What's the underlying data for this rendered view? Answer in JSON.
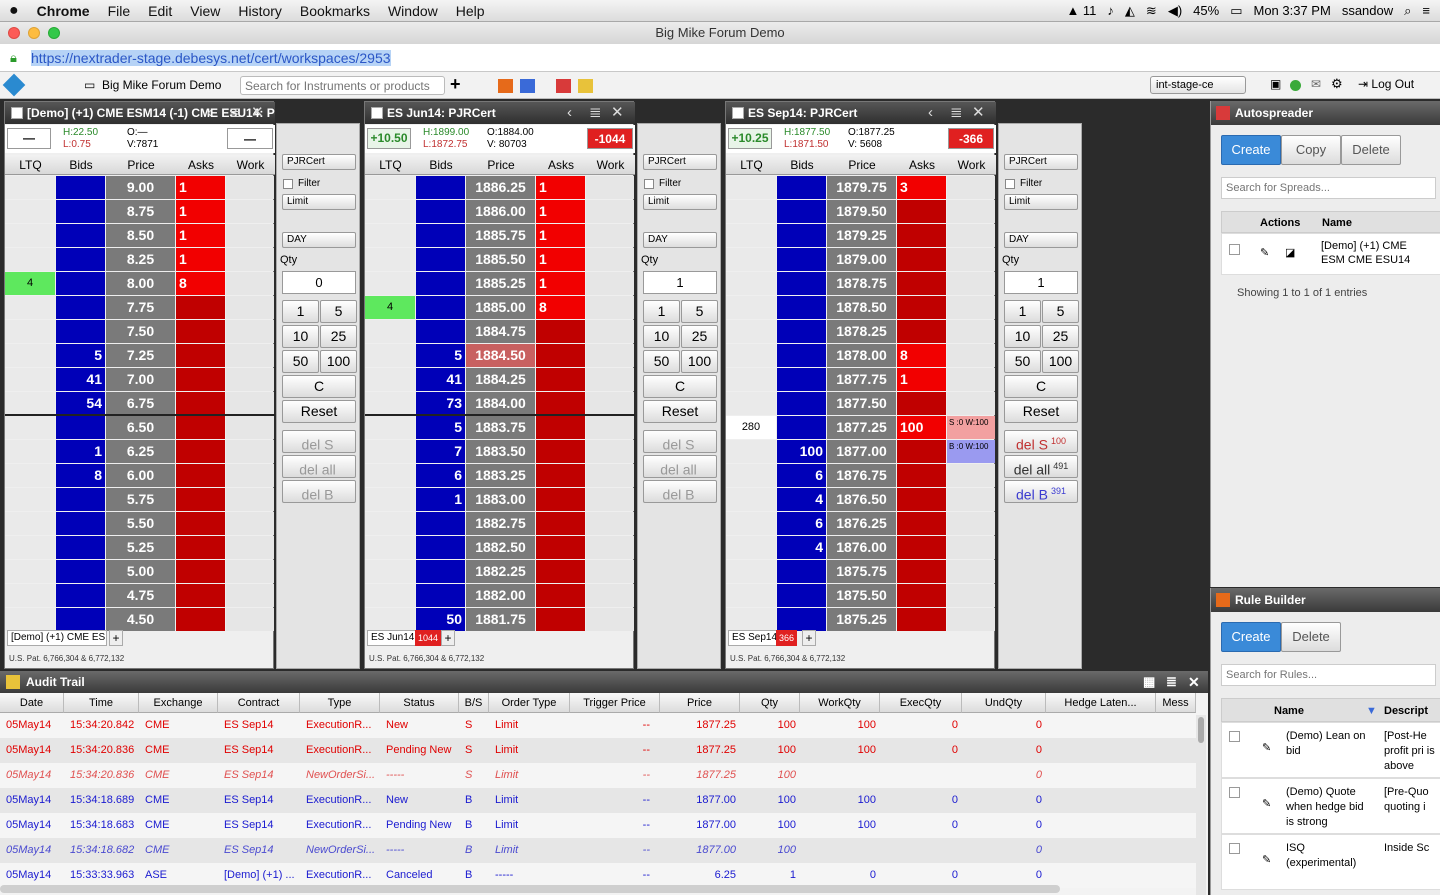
{
  "menubar": {
    "apple": "",
    "app": "Chrome",
    "items": [
      "File",
      "Edit",
      "View",
      "History",
      "Bookmarks",
      "Window",
      "Help"
    ],
    "adobe": "11",
    "battery": "45%",
    "clock": "Mon 3:37 PM",
    "user": "ssandow"
  },
  "window": {
    "title": "Big Mike Forum Demo"
  },
  "url": {
    "value": "https://nextrader-stage.debesys.net/cert/workspaces/2953"
  },
  "toolbar": {
    "workspace": "Big Mike Forum Demo",
    "search_placeholder": "Search for Instruments or products",
    "env": "int-stage-ce",
    "logout": "Log Out"
  },
  "ladders": [
    {
      "title": "[Demo] (+1) CME ESM14 (-1) CME ESU14: PJRCert",
      "net": "—",
      "net_right": "—",
      "h": "H:22.50",
      "l": "L:0.75",
      "o": "O:—",
      "v": "V:7871",
      "pos_color": "#ccc",
      "tab": "[Demo] (+1) CME ESI",
      "tab_badge": "",
      "patent": "U.S. Pat. 6,766,304 & 6,772,132",
      "rows": [
        [
          "",
          "",
          "9.00",
          "1",
          ""
        ],
        [
          "",
          "",
          "8.75",
          "1",
          ""
        ],
        [
          "",
          "",
          "8.50",
          "1",
          ""
        ],
        [
          "",
          "",
          "8.25",
          "1",
          ""
        ],
        [
          "4",
          "",
          "8.00",
          "8",
          ""
        ],
        [
          "",
          "",
          "7.75",
          "",
          ""
        ],
        [
          "",
          "",
          "7.50",
          "",
          ""
        ],
        [
          "",
          "5",
          "7.25",
          "",
          ""
        ],
        [
          "",
          "41",
          "7.00",
          "",
          ""
        ],
        [
          "",
          "54",
          "6.75",
          "",
          ""
        ],
        [
          "",
          "",
          "6.50",
          "",
          ""
        ],
        [
          "",
          "1",
          "6.25",
          "",
          ""
        ],
        [
          "",
          "8",
          "6.00",
          "",
          ""
        ],
        [
          "",
          "",
          "5.75",
          "",
          ""
        ],
        [
          "",
          "",
          "5.50",
          "",
          ""
        ],
        [
          "",
          "",
          "5.25",
          "",
          ""
        ],
        [
          "",
          "",
          "5.00",
          "",
          ""
        ],
        [
          "",
          "",
          "4.75",
          "",
          ""
        ],
        [
          "",
          "",
          "4.50",
          "",
          ""
        ]
      ]
    },
    {
      "title": "ES Jun14: PJRCert",
      "net": "+10.50",
      "net_right": "-1044",
      "h": "H:1899.00",
      "l": "L:1872.75",
      "o": "O:1884.00",
      "v": "V: 80703",
      "tab": "ES Jun14",
      "tab_badge": "1044",
      "patent": "U.S. Pat. 6,766,304 & 6,772,132",
      "rows": [
        [
          "",
          "",
          "1886.25",
          "1",
          ""
        ],
        [
          "",
          "",
          "1886.00",
          "1",
          ""
        ],
        [
          "",
          "",
          "1885.75",
          "1",
          ""
        ],
        [
          "",
          "",
          "1885.50",
          "1",
          ""
        ],
        [
          "",
          "",
          "1885.25",
          "1",
          ""
        ],
        [
          "4",
          "",
          "1885.00",
          "8",
          ""
        ],
        [
          "",
          "",
          "1884.75",
          "",
          ""
        ],
        [
          "",
          "5",
          "1884.50",
          "",
          ""
        ],
        [
          "",
          "41",
          "1884.25",
          "",
          ""
        ],
        [
          "",
          "73",
          "1884.00",
          "",
          ""
        ],
        [
          "",
          "5",
          "1883.75",
          "",
          ""
        ],
        [
          "",
          "7",
          "1883.50",
          "",
          ""
        ],
        [
          "",
          "6",
          "1883.25",
          "",
          ""
        ],
        [
          "",
          "1",
          "1883.00",
          "",
          ""
        ],
        [
          "",
          "",
          "1882.75",
          "",
          ""
        ],
        [
          "",
          "",
          "1882.50",
          "",
          ""
        ],
        [
          "",
          "",
          "1882.25",
          "",
          ""
        ],
        [
          "",
          "",
          "1882.00",
          "",
          ""
        ],
        [
          "",
          "50",
          "1881.75",
          "",
          ""
        ]
      ]
    },
    {
      "title": "ES Sep14: PJRCert",
      "net": "+10.25",
      "net_right": "-366",
      "h": "H:1877.50",
      "l": "L:1871.50",
      "o": "O:1877.25",
      "v": "V: 5608",
      "tab": "ES Sep14",
      "tab_badge": "366",
      "patent": "U.S. Pat. 6,766,304 & 6,772,132",
      "rows": [
        [
          "",
          "",
          "1879.75",
          "3",
          ""
        ],
        [
          "",
          "",
          "1879.50",
          "",
          ""
        ],
        [
          "",
          "",
          "1879.25",
          "",
          ""
        ],
        [
          "",
          "",
          "1879.00",
          "",
          ""
        ],
        [
          "",
          "",
          "1878.75",
          "",
          ""
        ],
        [
          "",
          "",
          "1878.50",
          "",
          ""
        ],
        [
          "",
          "",
          "1878.25",
          "",
          ""
        ],
        [
          "",
          "",
          "1878.00",
          "8",
          ""
        ],
        [
          "",
          "",
          "1877.75",
          "1",
          ""
        ],
        [
          "",
          "",
          "1877.50",
          "",
          ""
        ],
        [
          "280",
          "",
          "1877.25",
          "100",
          "S :0 W:100"
        ],
        [
          "",
          "100",
          "1877.00",
          "",
          "B :0 W:100"
        ],
        [
          "",
          "6",
          "1876.75",
          "",
          ""
        ],
        [
          "",
          "4",
          "1876.50",
          "",
          ""
        ],
        [
          "",
          "6",
          "1876.25",
          "",
          ""
        ],
        [
          "",
          "4",
          "1876.00",
          "",
          ""
        ],
        [
          "",
          "",
          "1875.75",
          "",
          ""
        ],
        [
          "",
          "",
          "1875.50",
          "",
          ""
        ],
        [
          "",
          "",
          "1875.25",
          "",
          ""
        ]
      ]
    }
  ],
  "col_headers": [
    "LTQ",
    "Bids",
    "Price",
    "Asks",
    "Work"
  ],
  "controls": [
    {
      "account": "PJRCert",
      "filter": "Filter",
      "type": "Limit",
      "tif": "DAY",
      "qty_label": "Qty",
      "qty": "0",
      "q": [
        "1",
        "5",
        "10",
        "25",
        "50",
        "100"
      ],
      "c": "C",
      "reset": "Reset",
      "dels": "del S",
      "delall": "del all",
      "delb": "del B",
      "dels_n": "",
      "delall_n": "",
      "delb_n": ""
    },
    {
      "account": "PJRCert",
      "filter": "Filter",
      "type": "Limit",
      "tif": "DAY",
      "qty_label": "Qty",
      "qty": "1",
      "q": [
        "1",
        "5",
        "10",
        "25",
        "50",
        "100"
      ],
      "c": "C",
      "reset": "Reset",
      "dels": "del S",
      "delall": "del all",
      "delb": "del B",
      "dels_n": "",
      "delall_n": "",
      "delb_n": ""
    },
    {
      "account": "PJRCert",
      "filter": "Filter",
      "type": "Limit",
      "tif": "DAY",
      "qty_label": "Qty",
      "qty": "1",
      "q": [
        "1",
        "5",
        "10",
        "25",
        "50",
        "100"
      ],
      "c": "C",
      "reset": "Reset",
      "dels": "del S",
      "delall": "del all",
      "delb": "del B",
      "dels_n": "100",
      "delall_n": "491",
      "delb_n": "391"
    }
  ],
  "autospreader": {
    "title": "Autospreader",
    "create": "Create",
    "copy": "Copy",
    "delete": "Delete",
    "search": "Search for Spreads...",
    "actions": "Actions",
    "name": "Name",
    "row": "[Demo] (+1) CME ESM CME ESU14",
    "showing": "Showing 1 to 1 of 1 entries"
  },
  "rulebuilder": {
    "title": "Rule Builder",
    "create": "Create",
    "delete": "Delete",
    "search": "Search for Rules...",
    "name": "Name",
    "desc": "Descript",
    "rows": [
      {
        "name": "(Demo) Lean on bid",
        "desc": "[Post-He profit pri is above"
      },
      {
        "name": "(Demo) Quote when hedge bid is strong",
        "desc": "[Pre-Quo quoting i"
      },
      {
        "name": "ISQ (experimental)",
        "desc": "Inside Sc"
      }
    ]
  },
  "audit": {
    "title": "Audit Trail",
    "headers": [
      "Date",
      "Time",
      "Exchange",
      "Contract",
      "Type",
      "Status",
      "B/S",
      "Order Type",
      "Trigger Price",
      "Price",
      "Qty",
      "WorkQty",
      "ExecQty",
      "UndQty",
      "Hedge Laten...",
      "Mess"
    ],
    "rows": [
      {
        "c": "#e00000",
        "i": false,
        "v": [
          "05May14",
          "15:34:20.842",
          "CME",
          "ES Sep14",
          "ExecutionR...",
          "New",
          "S",
          "Limit",
          "--",
          "1877.25",
          "100",
          "100",
          "0",
          "0"
        ]
      },
      {
        "c": "#e00000",
        "i": false,
        "v": [
          "05May14",
          "15:34:20.836",
          "CME",
          "ES Sep14",
          "ExecutionR...",
          "Pending New",
          "S",
          "Limit",
          "--",
          "1877.25",
          "100",
          "100",
          "0",
          "0"
        ]
      },
      {
        "c": "#e05050",
        "i": true,
        "v": [
          "05May14",
          "15:34:20.836",
          "CME",
          "ES Sep14",
          "NewOrderSi...",
          "-----",
          "S",
          "Limit",
          "--",
          "1877.25",
          "100",
          "",
          "",
          "0"
        ]
      },
      {
        "c": "#1a1ad0",
        "i": false,
        "v": [
          "05May14",
          "15:34:18.689",
          "CME",
          "ES Sep14",
          "ExecutionR...",
          "New",
          "B",
          "Limit",
          "--",
          "1877.00",
          "100",
          "100",
          "0",
          "0"
        ]
      },
      {
        "c": "#1a1ad0",
        "i": false,
        "v": [
          "05May14",
          "15:34:18.683",
          "CME",
          "ES Sep14",
          "ExecutionR...",
          "Pending New",
          "B",
          "Limit",
          "--",
          "1877.00",
          "100",
          "100",
          "0",
          "0"
        ]
      },
      {
        "c": "#4a4ad0",
        "i": true,
        "v": [
          "05May14",
          "15:34:18.682",
          "CME",
          "ES Sep14",
          "NewOrderSi...",
          "-----",
          "B",
          "Limit",
          "--",
          "1877.00",
          "100",
          "",
          "",
          "0"
        ]
      },
      {
        "c": "#1a1ad0",
        "i": false,
        "v": [
          "05May14",
          "15:33:33.963",
          "ASE",
          "[Demo] (+1) ...",
          "ExecutionR...",
          "Canceled",
          "B",
          "-----",
          "--",
          "6.25",
          "1",
          "0",
          "0",
          "0"
        ]
      }
    ]
  }
}
